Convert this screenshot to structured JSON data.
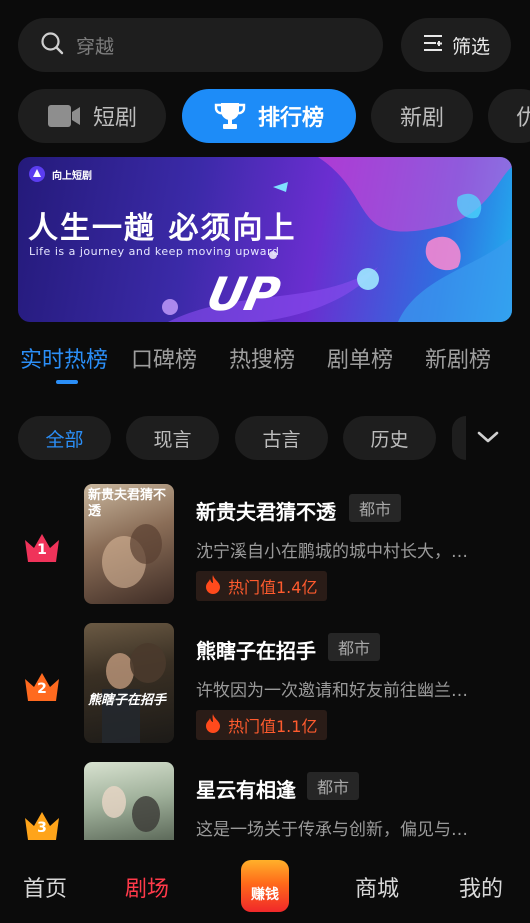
{
  "search": {
    "placeholder": "穿越",
    "filter_label": "筛选"
  },
  "categories": [
    {
      "label": "短剧",
      "icon": "video-camera-icon",
      "active": false
    },
    {
      "label": "排行榜",
      "icon": "trophy-icon",
      "active": true
    },
    {
      "label": "新剧",
      "active": false
    },
    {
      "label": "优",
      "active": false
    }
  ],
  "banner": {
    "brand": "向上短剧",
    "headline": "人生一趟  必须向上",
    "subline": "Life is a journey and  keep moving upward",
    "logo_text": "UP"
  },
  "rank_tabs": [
    "实时热榜",
    "口碑榜",
    "热搜榜",
    "剧单榜",
    "新剧榜"
  ],
  "genres": [
    "全部",
    "现言",
    "古言",
    "历史"
  ],
  "dramas": [
    {
      "rank": "1",
      "title": "新贵夫君猜不透",
      "genre": "都市",
      "desc": "沈宁溪自小在鹏城的城中村长大，…",
      "hot": "热门值1.4亿",
      "poster_text": "新贵夫君猜不透",
      "crown_color": "#f0335a"
    },
    {
      "rank": "2",
      "title": "熊瞎子在招手",
      "genre": "都市",
      "desc": "许牧因为一次邀请和好友前往幽兰…",
      "hot": "热门值1.1亿",
      "poster_text": "熊瞎子在招手",
      "crown_color": "#ff6a1f"
    },
    {
      "rank": "3",
      "title": "星云有相逢",
      "genre": "都市",
      "desc": "这是一场关于传承与创新，偏见与…",
      "hot": "",
      "poster_text": "",
      "crown_color": "#ffa41a"
    }
  ],
  "nav": {
    "home": "首页",
    "theater": "剧场",
    "earn": "赚钱",
    "mall": "商城",
    "mine": "我的"
  },
  "colors": {
    "accent_blue": "#1d8cf8",
    "nav_active": "#ff3a4a",
    "hot_text": "#ff5b2e"
  }
}
